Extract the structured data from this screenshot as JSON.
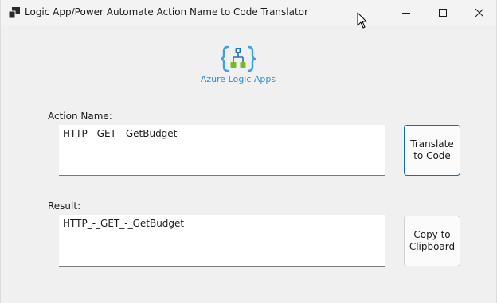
{
  "window": {
    "title": "Logic App/Power Automate Action Name to Code Translator"
  },
  "logo": {
    "caption": "Azure Logic Apps",
    "icon": "azure-logic-apps-icon",
    "accent_color": "#2e8fd0"
  },
  "form": {
    "action_label": "Action Name:",
    "action_value": "HTTP - GET - GetBudget",
    "result_label": "Result:",
    "result_value": "HTTP_-_GET_-_GetBudget"
  },
  "buttons": {
    "translate_line1": "Translate",
    "translate_line2": "to Code",
    "copy_line1": "Copy to",
    "copy_line2": "Clipboard"
  },
  "colors": {
    "focus_border": "#0f6cbd",
    "window_bg": "#f0f0f0"
  }
}
